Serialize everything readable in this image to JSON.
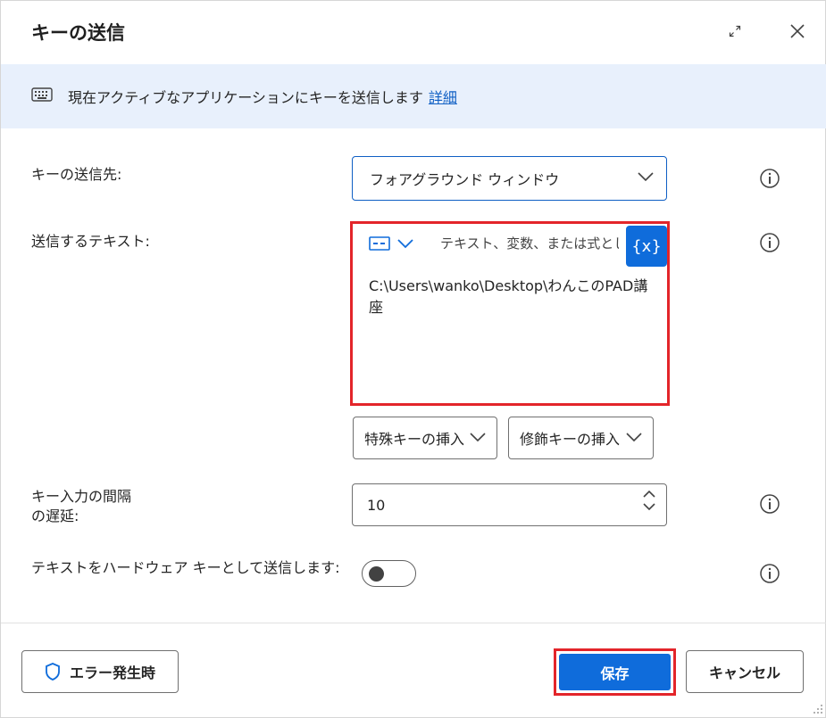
{
  "dialog": {
    "title": "キーの送信",
    "expand_icon": "expand-icon",
    "close_icon": "close-icon"
  },
  "info": {
    "icon": "keyboard-icon",
    "text": "現在アクティブなアプリケーションにキーを送信します",
    "link": "詳細"
  },
  "fields": {
    "target_label": "キーの送信先:",
    "target_value": "フォアグラウンド ウィンドウ",
    "text_label": "送信するテキスト:",
    "text_placeholder": "テキスト、変数、または式として",
    "text_var_button": "{x}",
    "text_value": "C:\\Users\\wanko\\Desktop\\わんこのPAD講座",
    "special_key_button": "特殊キーの挿入",
    "modifier_key_button": "修飾キーの挿入",
    "delay_label_line1": "キー入力の間隔",
    "delay_label_line2": "の遅延:",
    "delay_value": "10",
    "hardware_label": "テキストをハードウェア キーとして送信します:",
    "hardware_toggle_on": false
  },
  "footer": {
    "error_button": "エラー発生時",
    "save_button": "保存",
    "cancel_button": "キャンセル"
  },
  "colors": {
    "accent": "#0f6cdb",
    "highlight": "#e3252a",
    "info_bar": "#e8f0fc"
  }
}
